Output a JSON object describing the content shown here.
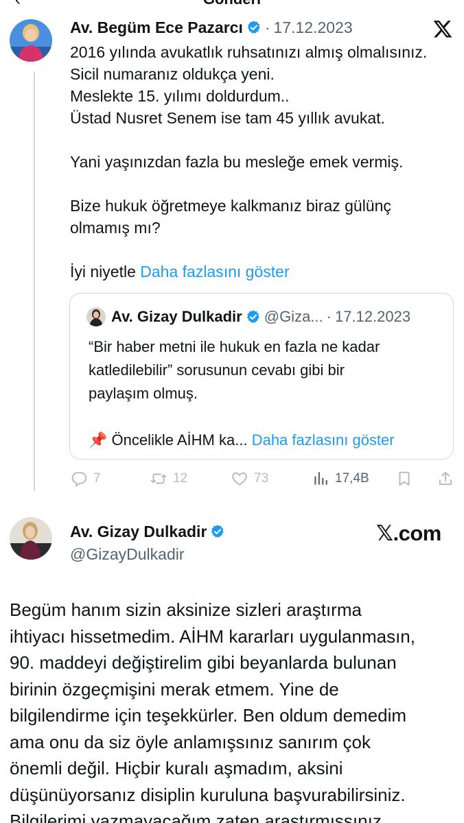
{
  "header": {
    "title": "Gönderi",
    "back_icon": "back-arrow-icon"
  },
  "tweet1": {
    "name": "Av. Begüm Ece Pazarcı",
    "sep": "·",
    "date": "17.12.2023",
    "lines": [
      "2016 yılında avukatlık ruhsatınızı almış olmalısınız.",
      "Sicil numaranız oldukça yeni.",
      "Meslekte 15. yılımı doldurdum..",
      "Üstad Nusret Senem ise tam 45 yıllık avukat.",
      "",
      "Yani yaşınızdan fazla bu mesleğe emek vermiş.",
      "",
      "Bize hukuk öğretmeye kalkmanız biraz gülünç",
      "olmamış mı?",
      ""
    ],
    "last_line": "İyi niyetle",
    "show_more": "Daha fazlasını göster",
    "quote": {
      "name": "Av. Gizay Dulkadir",
      "handle": "@Giza...",
      "sep": "·",
      "date": "17.12.2023",
      "lines": [
        "“Bir haber metni ile hukuk en fazla ne kadar",
        "katledilebilir” sorusunun cevabı gibi bir",
        "paylaşım olmuş.",
        ""
      ],
      "last_line": "📌 Öncelikle AİHM ka...",
      "show_more": "Daha fazlasını göster"
    },
    "actions": {
      "replies": "7",
      "reposts": "12",
      "likes": "73",
      "views": "17,4B"
    }
  },
  "tweet2": {
    "name": "Av. Gizay Dulkadir",
    "handle": "@GizayDulkadir",
    "source": "𝕏.com",
    "lines": [
      "Begüm hanım sizin aksinize sizleri araştırma",
      "ihtiyacı hissetmedim. AİHM kararları uygulanmasın,",
      "90. maddeyi değiştirelim gibi beyanlarda bulunan",
      "birinin özgeçmişini merak etmem. Yine de",
      "bilgilendirme için teşekkürler. Ben oldum demedim",
      "ama onu da siz öyle anlamışsınız sanırım çok",
      "önemli değil. Hiçbir kuralı aşmadım, aksini",
      "düşünüyorsanız disiplin kuruluna başvurabilirsiniz.",
      "Bilgilerimi yazmayacağım zaten araştırmışsınız"
    ]
  },
  "colors": {
    "accent": "#1d9bf0",
    "muted": "#536471",
    "border": "#cfd9de",
    "faded_icon": "#b3bcc4"
  }
}
